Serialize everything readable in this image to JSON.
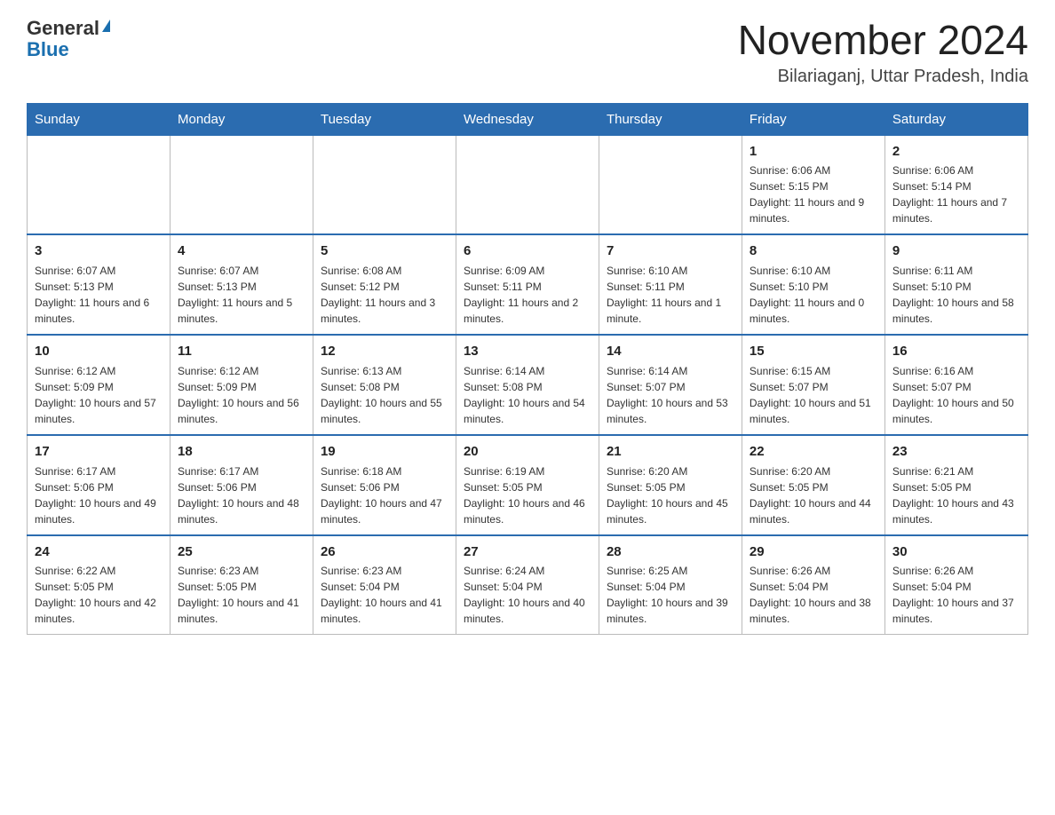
{
  "header": {
    "logo_general": "General",
    "logo_blue": "Blue",
    "month_title": "November 2024",
    "location": "Bilariaganj, Uttar Pradesh, India"
  },
  "weekdays": [
    "Sunday",
    "Monday",
    "Tuesday",
    "Wednesday",
    "Thursday",
    "Friday",
    "Saturday"
  ],
  "weeks": [
    [
      {
        "day": "",
        "info": ""
      },
      {
        "day": "",
        "info": ""
      },
      {
        "day": "",
        "info": ""
      },
      {
        "day": "",
        "info": ""
      },
      {
        "day": "",
        "info": ""
      },
      {
        "day": "1",
        "info": "Sunrise: 6:06 AM\nSunset: 5:15 PM\nDaylight: 11 hours and 9 minutes."
      },
      {
        "day": "2",
        "info": "Sunrise: 6:06 AM\nSunset: 5:14 PM\nDaylight: 11 hours and 7 minutes."
      }
    ],
    [
      {
        "day": "3",
        "info": "Sunrise: 6:07 AM\nSunset: 5:13 PM\nDaylight: 11 hours and 6 minutes."
      },
      {
        "day": "4",
        "info": "Sunrise: 6:07 AM\nSunset: 5:13 PM\nDaylight: 11 hours and 5 minutes."
      },
      {
        "day": "5",
        "info": "Sunrise: 6:08 AM\nSunset: 5:12 PM\nDaylight: 11 hours and 3 minutes."
      },
      {
        "day": "6",
        "info": "Sunrise: 6:09 AM\nSunset: 5:11 PM\nDaylight: 11 hours and 2 minutes."
      },
      {
        "day": "7",
        "info": "Sunrise: 6:10 AM\nSunset: 5:11 PM\nDaylight: 11 hours and 1 minute."
      },
      {
        "day": "8",
        "info": "Sunrise: 6:10 AM\nSunset: 5:10 PM\nDaylight: 11 hours and 0 minutes."
      },
      {
        "day": "9",
        "info": "Sunrise: 6:11 AM\nSunset: 5:10 PM\nDaylight: 10 hours and 58 minutes."
      }
    ],
    [
      {
        "day": "10",
        "info": "Sunrise: 6:12 AM\nSunset: 5:09 PM\nDaylight: 10 hours and 57 minutes."
      },
      {
        "day": "11",
        "info": "Sunrise: 6:12 AM\nSunset: 5:09 PM\nDaylight: 10 hours and 56 minutes."
      },
      {
        "day": "12",
        "info": "Sunrise: 6:13 AM\nSunset: 5:08 PM\nDaylight: 10 hours and 55 minutes."
      },
      {
        "day": "13",
        "info": "Sunrise: 6:14 AM\nSunset: 5:08 PM\nDaylight: 10 hours and 54 minutes."
      },
      {
        "day": "14",
        "info": "Sunrise: 6:14 AM\nSunset: 5:07 PM\nDaylight: 10 hours and 53 minutes."
      },
      {
        "day": "15",
        "info": "Sunrise: 6:15 AM\nSunset: 5:07 PM\nDaylight: 10 hours and 51 minutes."
      },
      {
        "day": "16",
        "info": "Sunrise: 6:16 AM\nSunset: 5:07 PM\nDaylight: 10 hours and 50 minutes."
      }
    ],
    [
      {
        "day": "17",
        "info": "Sunrise: 6:17 AM\nSunset: 5:06 PM\nDaylight: 10 hours and 49 minutes."
      },
      {
        "day": "18",
        "info": "Sunrise: 6:17 AM\nSunset: 5:06 PM\nDaylight: 10 hours and 48 minutes."
      },
      {
        "day": "19",
        "info": "Sunrise: 6:18 AM\nSunset: 5:06 PM\nDaylight: 10 hours and 47 minutes."
      },
      {
        "day": "20",
        "info": "Sunrise: 6:19 AM\nSunset: 5:05 PM\nDaylight: 10 hours and 46 minutes."
      },
      {
        "day": "21",
        "info": "Sunrise: 6:20 AM\nSunset: 5:05 PM\nDaylight: 10 hours and 45 minutes."
      },
      {
        "day": "22",
        "info": "Sunrise: 6:20 AM\nSunset: 5:05 PM\nDaylight: 10 hours and 44 minutes."
      },
      {
        "day": "23",
        "info": "Sunrise: 6:21 AM\nSunset: 5:05 PM\nDaylight: 10 hours and 43 minutes."
      }
    ],
    [
      {
        "day": "24",
        "info": "Sunrise: 6:22 AM\nSunset: 5:05 PM\nDaylight: 10 hours and 42 minutes."
      },
      {
        "day": "25",
        "info": "Sunrise: 6:23 AM\nSunset: 5:05 PM\nDaylight: 10 hours and 41 minutes."
      },
      {
        "day": "26",
        "info": "Sunrise: 6:23 AM\nSunset: 5:04 PM\nDaylight: 10 hours and 41 minutes."
      },
      {
        "day": "27",
        "info": "Sunrise: 6:24 AM\nSunset: 5:04 PM\nDaylight: 10 hours and 40 minutes."
      },
      {
        "day": "28",
        "info": "Sunrise: 6:25 AM\nSunset: 5:04 PM\nDaylight: 10 hours and 39 minutes."
      },
      {
        "day": "29",
        "info": "Sunrise: 6:26 AM\nSunset: 5:04 PM\nDaylight: 10 hours and 38 minutes."
      },
      {
        "day": "30",
        "info": "Sunrise: 6:26 AM\nSunset: 5:04 PM\nDaylight: 10 hours and 37 minutes."
      }
    ]
  ]
}
